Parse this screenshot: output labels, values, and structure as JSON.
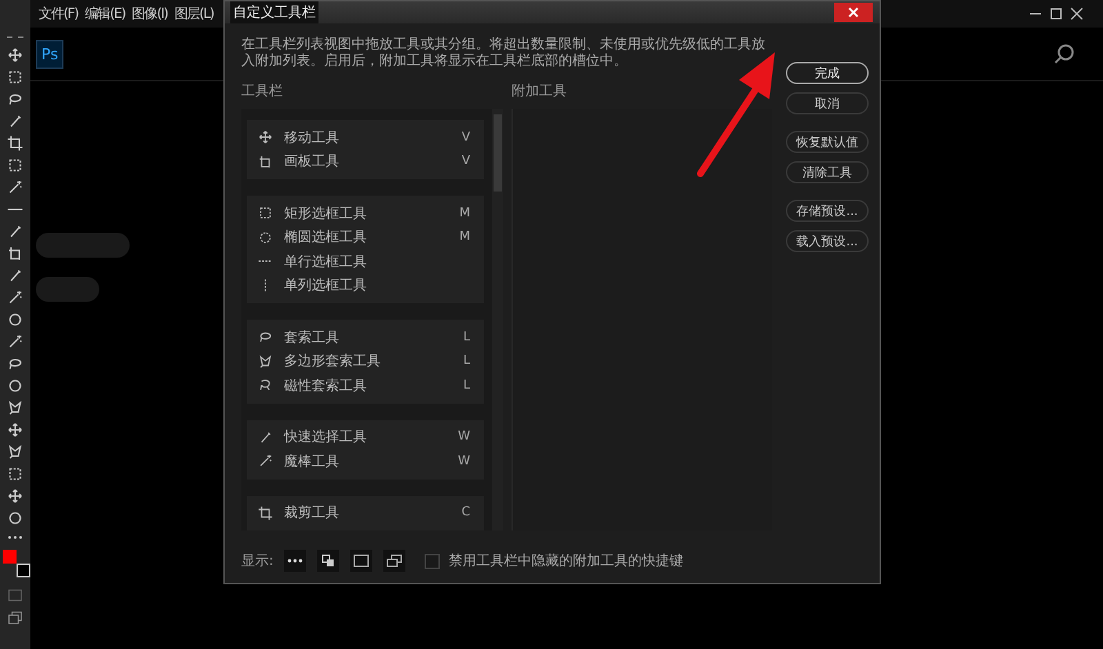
{
  "menu": [
    "文件(F)",
    "编辑(E)",
    "图像(I)",
    "图层(L)"
  ],
  "app_logo": "Ps",
  "swatches": [
    {
      "color": "#ff0000"
    },
    {
      "color": "#000000"
    }
  ],
  "dialog": {
    "title": "自定义工具栏",
    "description": "在工具栏列表视图中拖放工具或其分组。将超出数量限制、未使用或优先级低的工具放入附加列表。启用后，附加工具将显示在工具栏底部的槽位中。",
    "toolbar_label": "工具栏",
    "extra_label": "附加工具",
    "groups": [
      {
        "tools": [
          {
            "kind": "move",
            "name": "移动工具",
            "key": "V"
          },
          {
            "kind": "artboard",
            "name": "画板工具",
            "key": "V"
          }
        ]
      },
      {
        "tools": [
          {
            "kind": "rect",
            "name": "矩形选框工具",
            "key": "M"
          },
          {
            "kind": "ellipse",
            "name": "椭圆选框工具",
            "key": "M"
          },
          {
            "kind": "row",
            "name": "单行选框工具"
          },
          {
            "kind": "column",
            "name": "单列选框工具"
          }
        ]
      },
      {
        "tools": [
          {
            "kind": "lasso",
            "name": "套索工具",
            "key": "L"
          },
          {
            "kind": "polylasso",
            "name": "多边形套索工具",
            "key": "L"
          },
          {
            "kind": "maglasso",
            "name": "磁性套索工具",
            "key": "L"
          }
        ]
      },
      {
        "tools": [
          {
            "kind": "quick",
            "name": "快速选择工具",
            "key": "W"
          },
          {
            "kind": "wand",
            "name": "魔棒工具",
            "key": "W"
          }
        ]
      },
      {
        "tools": [
          {
            "kind": "crop",
            "name": "裁剪工具",
            "key": "C"
          }
        ]
      }
    ],
    "buttons": [
      {
        "label": "完成",
        "primary": true
      },
      {
        "label": "取消",
        "primary": false
      },
      {
        "label": "恢复默认值",
        "primary": false
      },
      {
        "label": "清除工具",
        "primary": false
      },
      {
        "label": "存储预设...",
        "primary": false
      },
      {
        "label": "载入预设...",
        "primary": false
      }
    ],
    "display_label": "显示:",
    "shortcut_option": {
      "label": "禁用工具栏中隐藏的附加工具的快捷键",
      "checked": false
    }
  }
}
